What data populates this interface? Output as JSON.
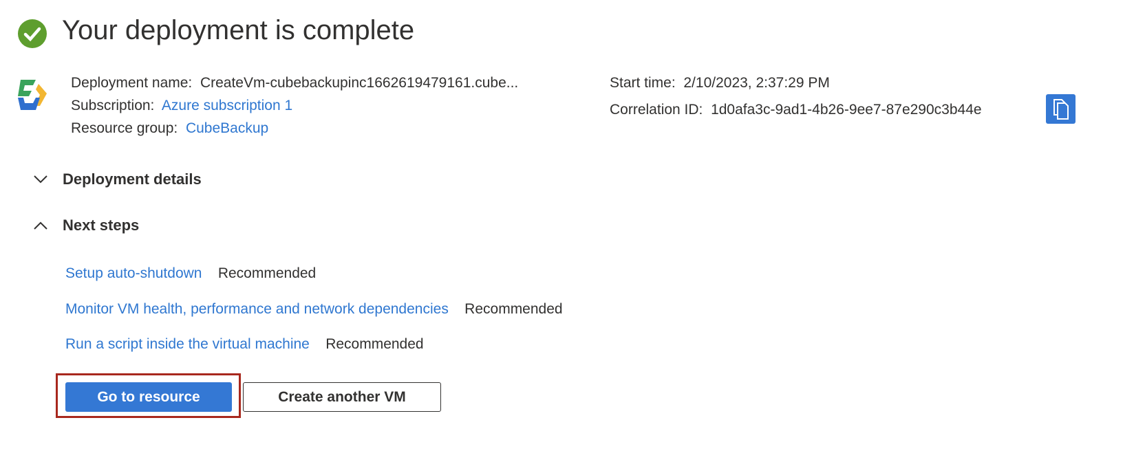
{
  "header": {
    "title": "Your deployment is complete",
    "status_icon": "check-circle-icon",
    "status_color": "#5e9e2e"
  },
  "info": {
    "deployment_name_label": "Deployment name:",
    "deployment_name": "CreateVm-cubebackupinc1662619479161.cube...",
    "subscription_label": "Subscription:",
    "subscription": "Azure subscription 1",
    "resource_group_label": "Resource group:",
    "resource_group": "CubeBackup",
    "start_time_label": "Start time:",
    "start_time": "2/10/2023, 2:37:29 PM",
    "correlation_label": "Correlation ID:",
    "correlation_id": "1d0afa3c-9ad1-4b26-9ee7-87e290c3b44e"
  },
  "sections": {
    "details": "Deployment details",
    "next_steps": "Next steps"
  },
  "steps": [
    {
      "link": "Setup auto-shutdown",
      "tag": "Recommended"
    },
    {
      "link": "Monitor VM health, performance and network dependencies",
      "tag": "Recommended"
    },
    {
      "link": "Run a script inside the virtual machine",
      "tag": "Recommended"
    }
  ],
  "buttons": {
    "go": "Go to resource",
    "create": "Create another VM"
  },
  "colors": {
    "accent": "#3478d4",
    "link": "#2f77d0",
    "highlight": "#a8281e"
  }
}
